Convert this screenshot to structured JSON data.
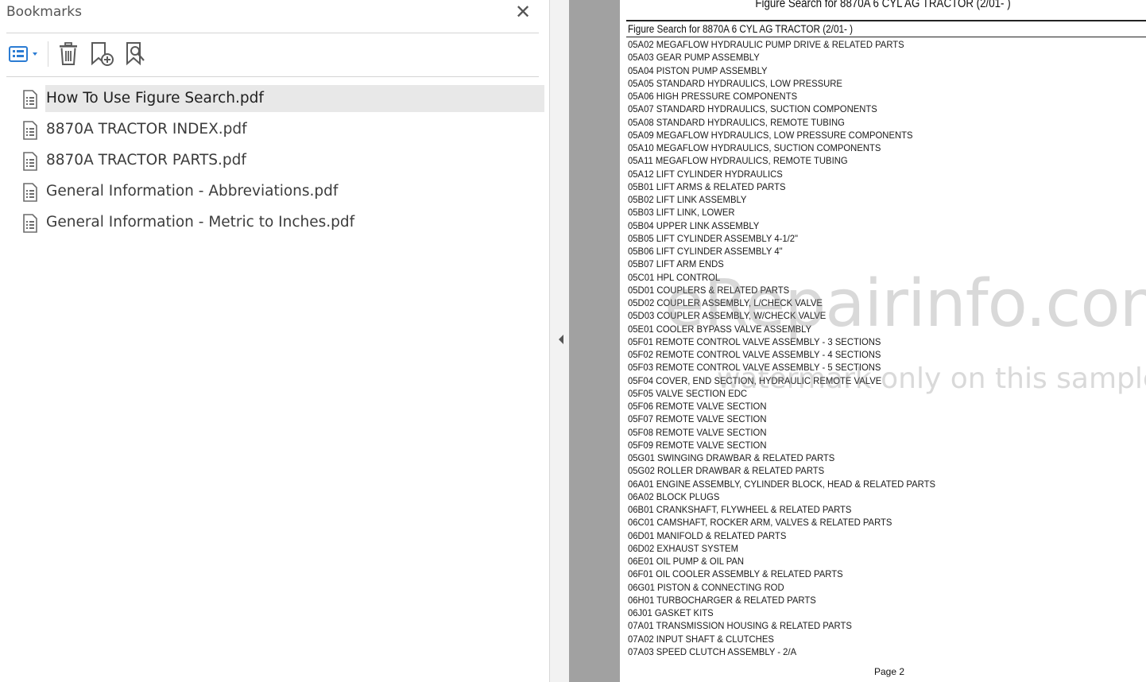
{
  "bookmarks_panel": {
    "title": "Bookmarks",
    "close_glyph": "✕",
    "toolbar": {
      "options_icon": "list-options-icon",
      "delete_icon": "trash-icon",
      "new_bookmark_icon": "add-bookmark-icon",
      "bookmark_from_selection_icon": "bookmark-search-icon"
    },
    "items": [
      {
        "label": "How To Use Figure Search.pdf",
        "selected": true
      },
      {
        "label": "8870A TRACTOR INDEX.pdf",
        "selected": false
      },
      {
        "label": "8870A TRACTOR PARTS.pdf",
        "selected": false
      },
      {
        "label": "General Information - Abbreviations.pdf",
        "selected": false
      },
      {
        "label": "General Information - Metric to Inches.pdf",
        "selected": false
      }
    ]
  },
  "document": {
    "header": "Figure Search for 8870A 6 CYL AG TRACTOR (2/01- )",
    "subtitle": "Figure Search for 8870A 6 CYL AG TRACTOR (2/01- )",
    "entries": [
      "05A02 MEGAFLOW HYDRAULIC PUMP DRIVE & RELATED PARTS",
      "05A03 GEAR PUMP ASSEMBLY",
      "05A04 PISTON PUMP ASSEMBLY",
      "05A05 STANDARD HYDRAULICS, LOW PRESSURE",
      "05A06 HIGH PRESSURE COMPONENTS",
      "05A07 STANDARD HYDRAULICS, SUCTION COMPONENTS",
      "05A08 STANDARD HYDRAULICS, REMOTE TUBING",
      "05A09 MEGAFLOW HYDRAULICS, LOW PRESSURE COMPONENTS",
      "05A10 MEGAFLOW HYDRAULICS, SUCTION COMPONENTS",
      "05A11 MEGAFLOW HYDRAULICS, REMOTE TUBING",
      "05A12 LIFT CYLINDER HYDRAULICS",
      "05B01 LIFT ARMS & RELATED PARTS",
      "05B02 LIFT LINK ASSEMBLY",
      "05B03 LIFT LINK, LOWER",
      "05B04 UPPER LINK ASSEMBLY",
      "05B05 LIFT CYLINDER ASSEMBLY 4-1/2\"",
      "05B06 LIFT CYLINDER ASSEMBLY 4\"",
      "05B07 LIFT ARM ENDS",
      "05C01 HPL CONTROL",
      "05D01 COUPLERS & RELATED PARTS",
      "05D02 COUPLER ASSEMBLY, L/CHECK VALVE",
      "05D03 COUPLER ASSEMBLY, W/CHECK VALVE",
      "05E01 COOLER BYPASS VALVE ASSEMBLY",
      "05F01 REMOTE CONTROL VALVE ASSEMBLY - 3 SECTIONS",
      "05F02 REMOTE CONTROL VALVE ASSEMBLY - 4 SECTIONS",
      "05F03 REMOTE CONTROL VALVE ASSEMBLY - 5 SECTIONS",
      "05F04 COVER, END SECTION, HYDRAULIC REMOTE VALVE",
      "05F05 VALVE SECTION EDC",
      "05F06 REMOTE VALVE SECTION",
      "05F07 REMOTE VALVE SECTION",
      "05F08 REMOTE VALVE SECTION",
      "05F09 REMOTE VALVE SECTION",
      "05G01 SWINGING DRAWBAR & RELATED PARTS",
      "05G02 ROLLER DRAWBAR & RELATED PARTS",
      "06A01 ENGINE ASSEMBLY, CYLINDER BLOCK, HEAD & RELATED PARTS",
      "06A02 BLOCK PLUGS",
      "06B01 CRANKSHAFT, FLYWHEEL & RELATED PARTS",
      "06C01 CAMSHAFT, ROCKER ARM, VALVES & RELATED PARTS",
      "06D01 MANIFOLD & RELATED PARTS",
      "06D02 EXHAUST SYSTEM",
      "06E01 OIL PUMP & OIL PAN",
      "06F01 OIL COOLER ASSEMBLY & RELATED PARTS",
      "06G01 PISTON & CONNECTING ROD",
      "06H01 TURBOCHARGER & RELATED PARTS",
      "06J01 GASKET KITS",
      "07A01 TRANSMISSION HOUSING & RELATED PARTS",
      "07A02 INPUT SHAFT & CLUTCHES",
      "07A03 SPEED CLUTCH ASSEMBLY - 2/A"
    ],
    "page_label": "Page 2",
    "watermark_line1": "eRepairinfo.com",
    "watermark_line2": "watermark only on this sample"
  },
  "colors": {
    "toolbar_blue": "#2b7cd3",
    "icon_gray": "#5a5a5a",
    "selection_bg": "#e8e8e8",
    "doc_background": "#a1a1a1"
  }
}
